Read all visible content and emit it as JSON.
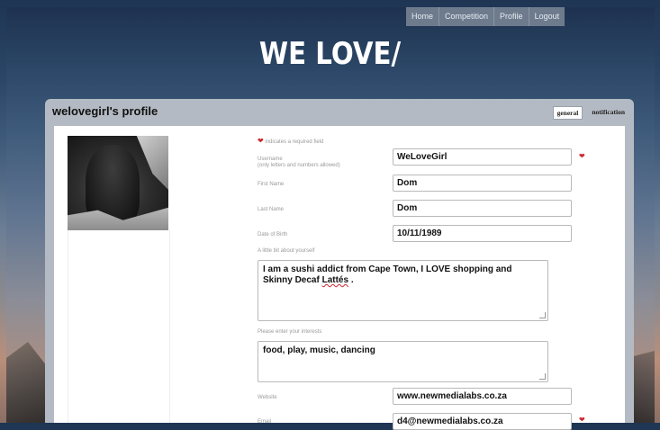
{
  "nav": {
    "items": [
      "Home",
      "Competition",
      "Profile",
      "Logout"
    ]
  },
  "logo": {
    "text": "WE LOVE/"
  },
  "profile": {
    "title": "welovegirl's profile",
    "tabs": [
      "general",
      "notification"
    ],
    "required_note": "indicates a required field",
    "fields": {
      "username": {
        "label": "Username",
        "hint": "(only letters and numbers allowed)",
        "value": "WeLoveGirl"
      },
      "first_name": {
        "label": "First Name",
        "value": "Dom"
      },
      "last_name": {
        "label": "Last Name",
        "value": "Dom"
      },
      "dob": {
        "label": "Date of Birth",
        "value": "10/11/1989"
      },
      "about": {
        "label": "A little bit about yourself",
        "value_main": "I am a sushi addict from Cape Town, I LOVE shopping and Skinny Decaf ",
        "value_spell": "Lattés",
        "value_end": " ."
      },
      "interests": {
        "label": "Please enter your interests",
        "value": "food, play, music, dancing"
      },
      "website": {
        "label": "Website",
        "value": "www.newmedialabs.co.za"
      },
      "email": {
        "label": "Email",
        "value": "d4@newmedialabs.co.za"
      }
    }
  },
  "colors": {
    "required_heart": "#d0282f",
    "panel": "#b4bac3",
    "nav": "#6d7b8d"
  }
}
